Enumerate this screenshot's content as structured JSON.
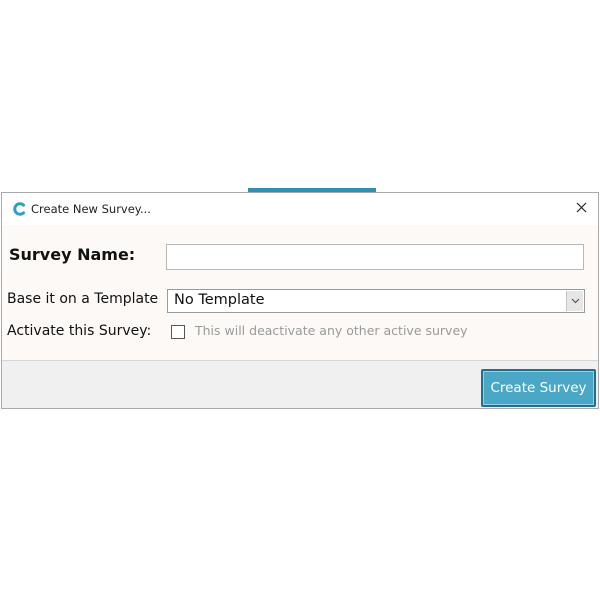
{
  "dialog": {
    "title": "Create New Survey...",
    "close_icon": "close-icon",
    "app_icon": "app-logo-icon"
  },
  "form": {
    "survey_name_label": "Survey Name:",
    "survey_name_value": "",
    "template_label": "Base it on a Template",
    "template_selected": "No Template",
    "activate_label": "Activate this Survey:",
    "activate_checked": false,
    "activate_note": "This will deactivate any other active survey"
  },
  "footer": {
    "create_button_label": "Create Survey"
  },
  "colors": {
    "accent": "#4aa8c6",
    "accent_border": "#226f8a",
    "body_bg": "#fdf9f6",
    "footer_bg": "#f0f0f0"
  }
}
